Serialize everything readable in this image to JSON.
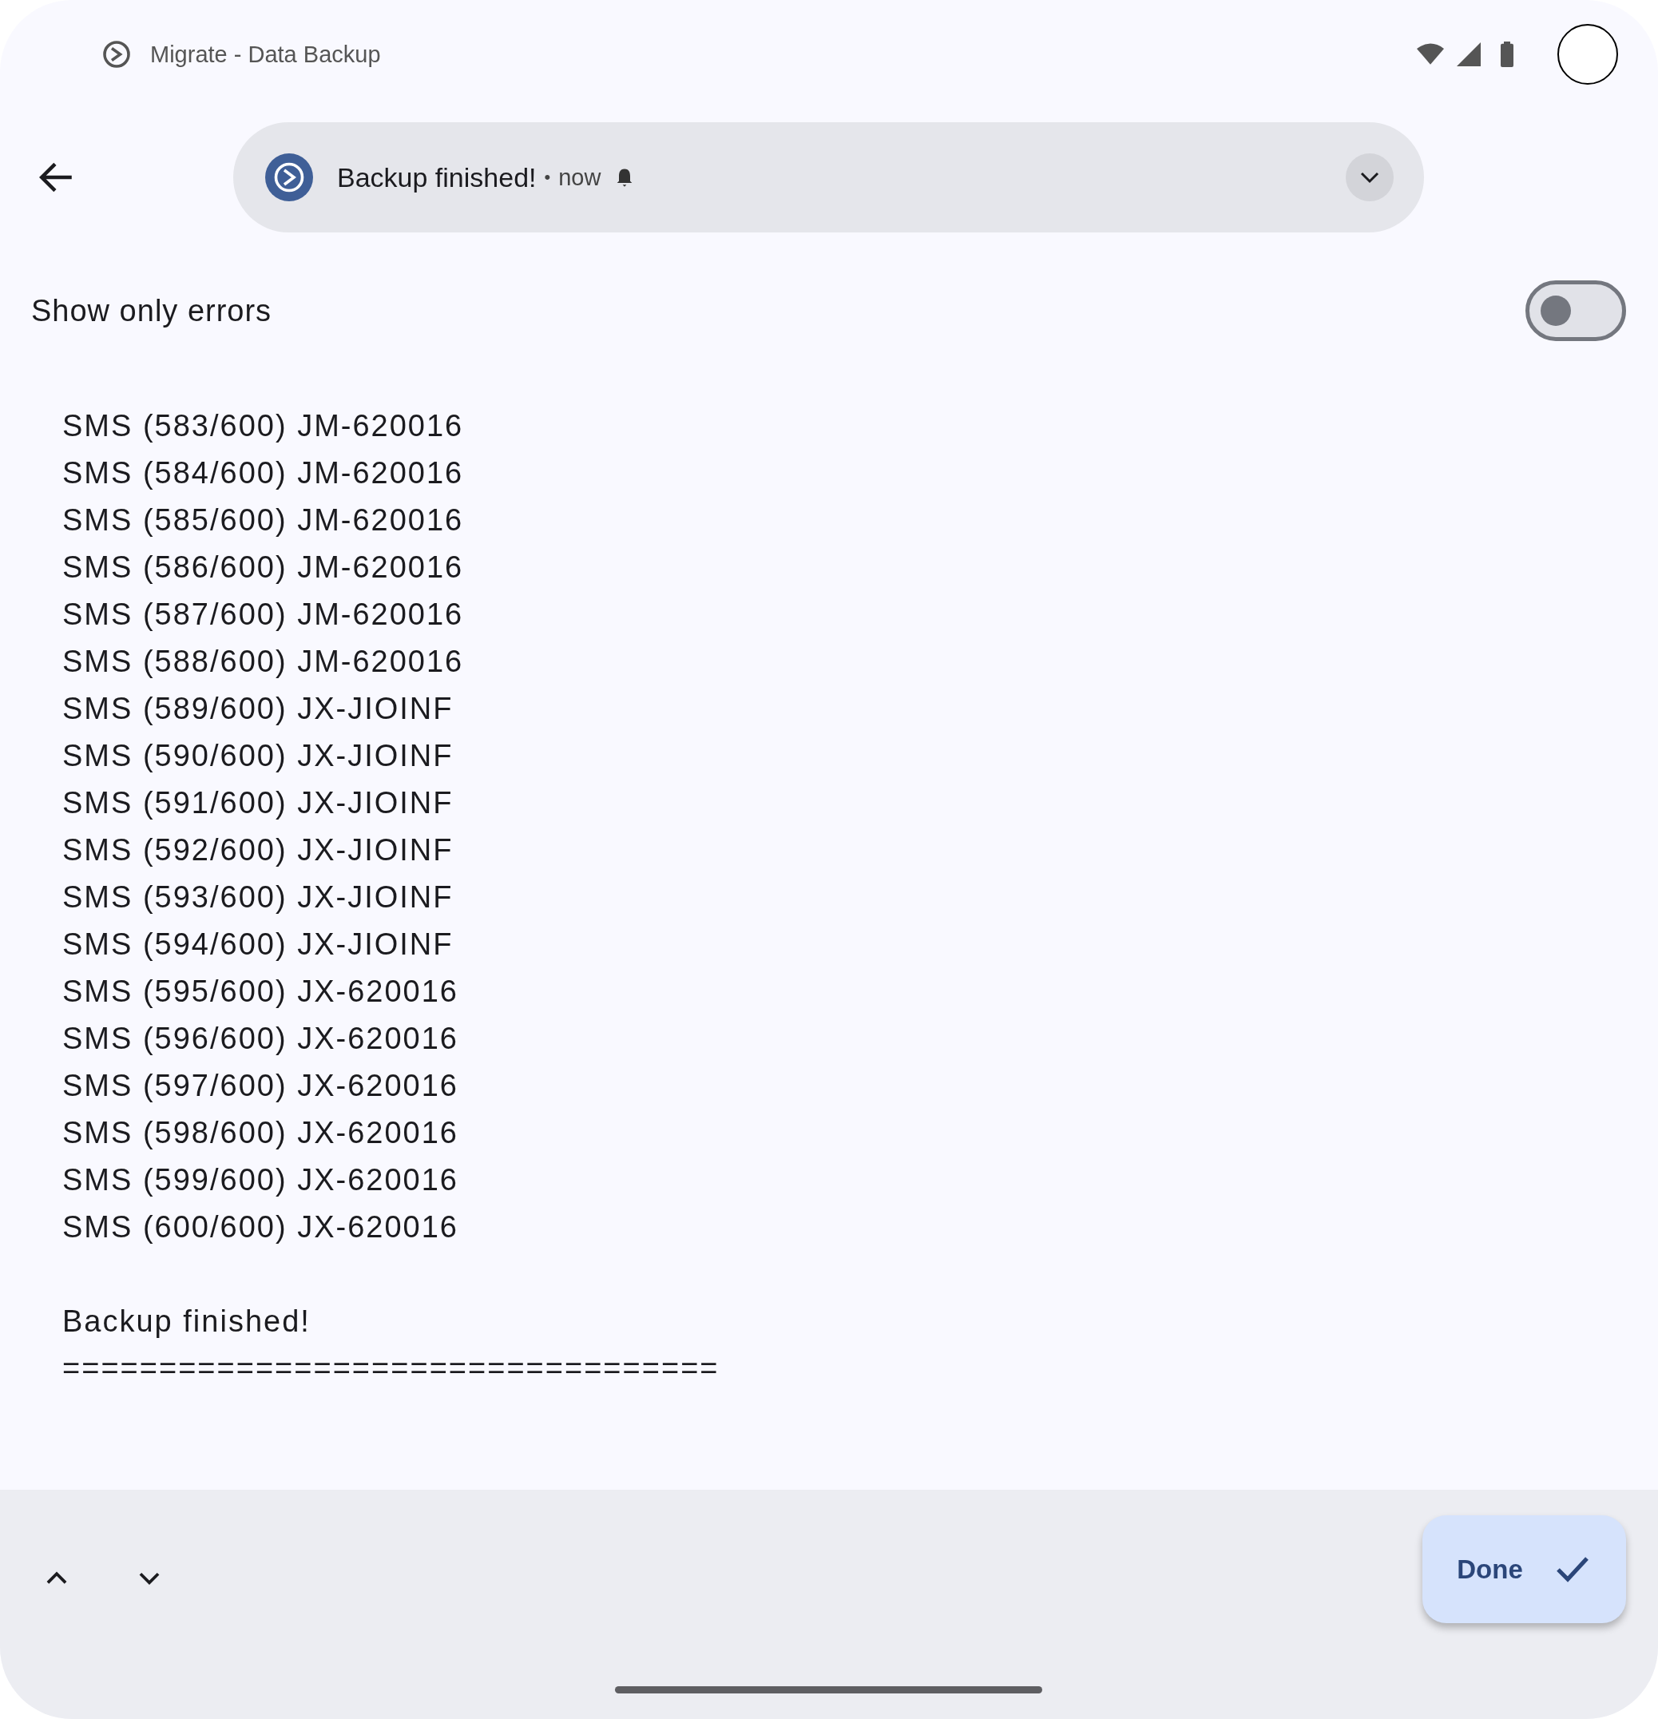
{
  "status_bar": {
    "title": "Migrate - Data Backup"
  },
  "notification": {
    "title": "Backup finished!",
    "separator": "•",
    "time": "now"
  },
  "filter_toggle": {
    "label": "Show only errors",
    "on": false
  },
  "log_lines": [
    "SMS (583/600) JM-620016",
    "SMS (584/600) JM-620016",
    "SMS (585/600) JM-620016",
    "SMS (586/600) JM-620016",
    "SMS (587/600) JM-620016",
    "SMS (588/600) JM-620016",
    "SMS (589/600) JX-JIOINF",
    "SMS (590/600) JX-JIOINF",
    "SMS (591/600) JX-JIOINF",
    "SMS (592/600) JX-JIOINF",
    "SMS (593/600) JX-JIOINF",
    "SMS (594/600) JX-JIOINF",
    "SMS (595/600) JX-620016",
    "SMS (596/600) JX-620016",
    "SMS (597/600) JX-620016",
    "SMS (598/600) JX-620016",
    "SMS (599/600) JX-620016",
    "SMS (600/600) JX-620016"
  ],
  "summary": {
    "message": "Backup finished!",
    "rule": "=================================="
  },
  "done_button": {
    "label": "Done"
  }
}
